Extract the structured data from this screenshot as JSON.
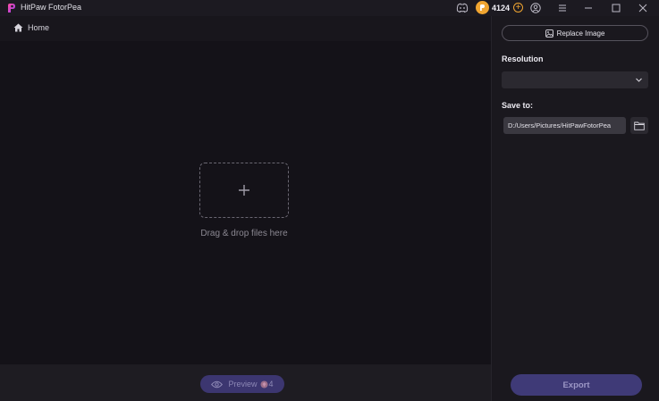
{
  "app": {
    "title": "HitPaw FotorPea"
  },
  "titlebar": {
    "credits": "4124",
    "icons": [
      "discord-icon",
      "coin-icon",
      "add-credits-icon",
      "account-icon",
      "menu-icon",
      "minimize-icon",
      "maximize-icon",
      "close-icon"
    ]
  },
  "nav": {
    "home_label": "Home"
  },
  "canvas": {
    "drop_text": "Drag & drop files here"
  },
  "bottom": {
    "preview_label": "Preview",
    "preview_cost": "4"
  },
  "sidebar": {
    "replace_label": "Replace Image",
    "resolution_label": "Resolution",
    "resolution_value": "",
    "save_to_label": "Save to:",
    "save_path": "D:/Users/Pictures/HitPawFotorPea",
    "export_label": "Export"
  },
  "colors": {
    "background": "#141218",
    "accent": "#3f3a77",
    "coin": "#f0a531"
  }
}
